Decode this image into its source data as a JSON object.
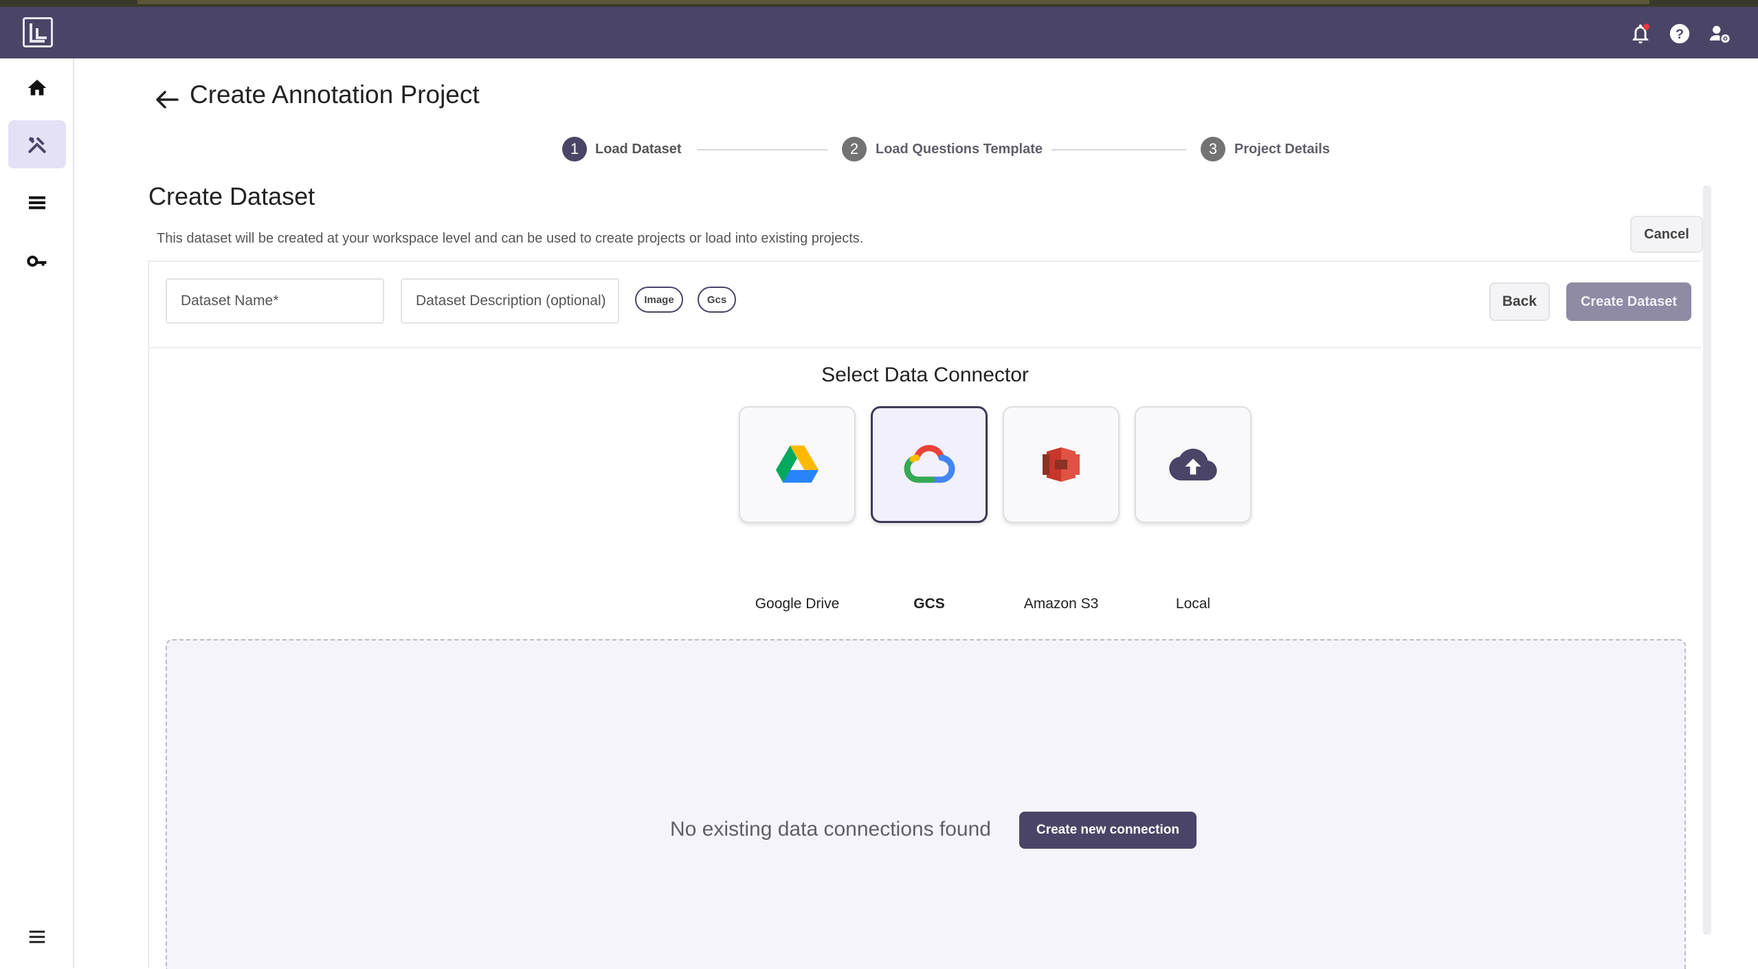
{
  "header": {
    "logo_icon": "app-logo-icon",
    "icons": [
      "notification-bell-icon",
      "help-icon",
      "user-settings-icon"
    ],
    "accent_color": "#4a4566"
  },
  "sidebar": {
    "items": [
      {
        "name": "home",
        "icon": "home-icon",
        "active": false
      },
      {
        "name": "tools",
        "icon": "tools-icon",
        "active": true
      },
      {
        "name": "datasets",
        "icon": "list-icon",
        "active": false
      },
      {
        "name": "keys",
        "icon": "key-icon",
        "active": false
      }
    ],
    "menu_icon": "hamburger-menu-icon"
  },
  "page": {
    "title": "Create Annotation Project"
  },
  "stepper": {
    "steps": [
      {
        "number": "1",
        "label": "Load Dataset",
        "active": true
      },
      {
        "number": "2",
        "label": "Load Questions Template",
        "active": false
      },
      {
        "number": "3",
        "label": "Project Details",
        "active": false
      }
    ]
  },
  "dataset": {
    "title": "Create Dataset",
    "description": "This dataset will be created at your workspace level and can be used to create projects or load into existing projects.",
    "cancel_label": "Cancel",
    "name_placeholder": "Dataset Name*",
    "description_placeholder": "Dataset Description (optional)",
    "chips": [
      "Image",
      "Gcs"
    ],
    "back_label": "Back",
    "create_label": "Create Dataset"
  },
  "connector": {
    "title": "Select Data Connector",
    "options": [
      {
        "label": "Google Drive",
        "icon": "google-drive-icon",
        "selected": false
      },
      {
        "label": "GCS",
        "icon": "google-cloud-icon",
        "selected": true
      },
      {
        "label": "Amazon S3",
        "icon": "amazon-s3-icon",
        "selected": false
      },
      {
        "label": "Local",
        "icon": "cloud-upload-icon",
        "selected": false
      }
    ],
    "empty_message": "No existing data connections found",
    "create_connection_label": "Create new connection"
  }
}
